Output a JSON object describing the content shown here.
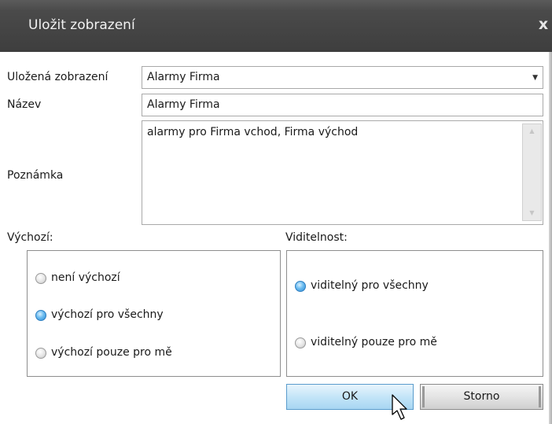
{
  "dialog": {
    "title": "Uložit zobrazení",
    "close_glyph": "x"
  },
  "form": {
    "saved_views_label": "Uložená zobrazení",
    "saved_views_value": "Alarmy Firma",
    "name_label": "Název",
    "name_value": "Alarmy Firma",
    "note_label": "Poznámka",
    "note_value": "alarmy pro Firma vchod, Firma východ"
  },
  "default_group": {
    "title": "Výchozí:",
    "options": [
      {
        "label": "není výchozí",
        "checked": false
      },
      {
        "label": "výchozí pro všechny",
        "checked": true
      },
      {
        "label": "výchozí pouze pro mě",
        "checked": false
      }
    ]
  },
  "visibility_group": {
    "title": "Viditelnost:",
    "options": [
      {
        "label": "viditelný pro všechny",
        "checked": true
      },
      {
        "label": "viditelný pouze pro mě",
        "checked": false
      }
    ]
  },
  "buttons": {
    "ok_label": "OK",
    "cancel_label": "Storno"
  },
  "icons": {
    "dropdown": "chevron-down-icon",
    "close": "close-icon",
    "cursor": "mouse-pointer-icon"
  }
}
